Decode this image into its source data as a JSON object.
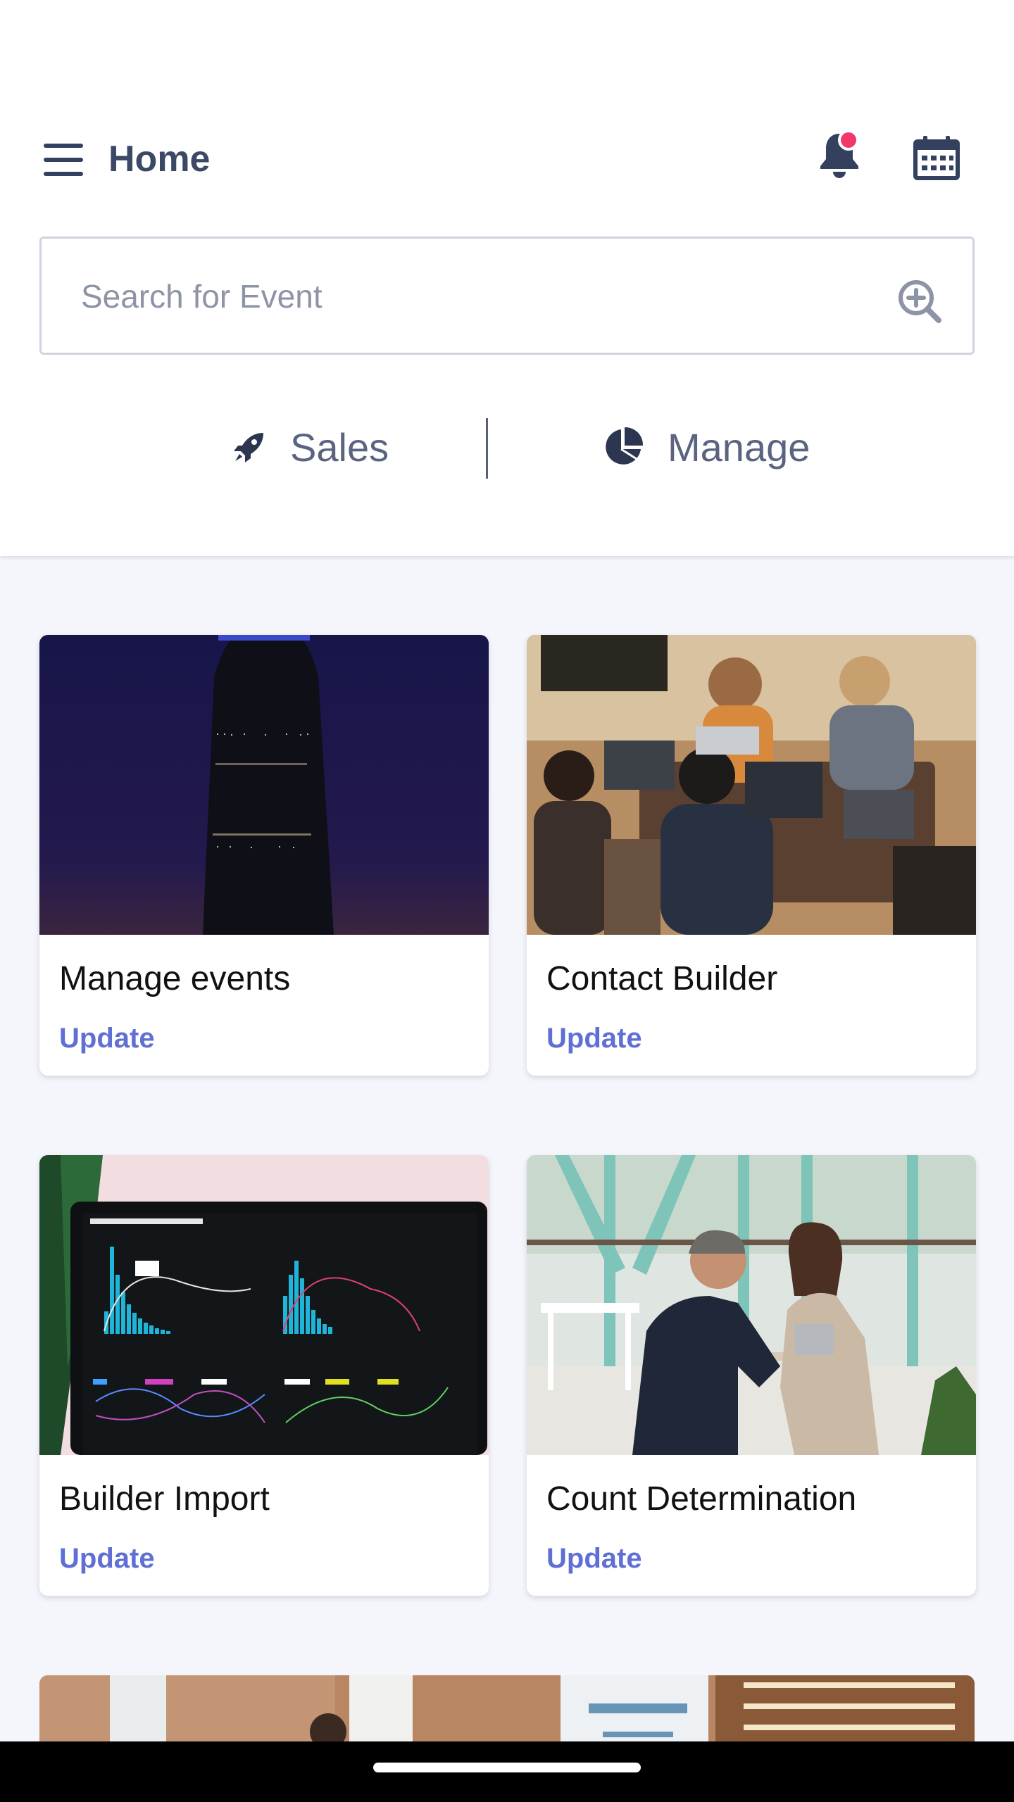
{
  "header": {
    "title": "Home",
    "menu_icon": "hamburger-menu-icon",
    "notification_icon": "bell-icon",
    "notification_dot_color": "#f0386b",
    "calendar_icon": "calendar-icon"
  },
  "search": {
    "placeholder": "Search for Event",
    "icon": "zoom-in-icon"
  },
  "segments": [
    {
      "label": "Sales",
      "icon": "rocket-icon"
    },
    {
      "label": "Manage",
      "icon": "pie-chart-icon"
    }
  ],
  "cards": [
    {
      "title": "Manage events",
      "action": "Update",
      "image": "night-skyscraper-photo"
    },
    {
      "title": "Contact Builder",
      "action": "Update",
      "image": "team-working-laptops-photo"
    },
    {
      "title": "Builder Import",
      "action": "Update",
      "image": "analytics-dashboard-laptop-photo"
    },
    {
      "title": "Count Determination",
      "action": "Update",
      "image": "two-people-meeting-cafe-photo"
    }
  ],
  "partial_card": {
    "image": "office-lobby-photo"
  },
  "colors": {
    "accent": "#5f6fd4",
    "heading": "#3b4866",
    "background": "#f5f6fb"
  }
}
